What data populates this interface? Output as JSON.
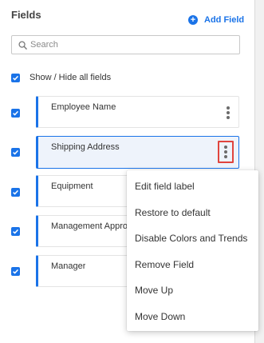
{
  "panel": {
    "title": "Fields",
    "add_field_label": "Add Field",
    "add_icon": "plus-circle-icon",
    "search": {
      "placeholder": "Search",
      "value": "",
      "icon": "search-icon"
    },
    "show_all": {
      "label": "Show / Hide all fields",
      "checked": true
    }
  },
  "fields": [
    {
      "label": "Employee Name",
      "checked": true,
      "selected": false
    },
    {
      "label": "Shipping Address",
      "checked": true,
      "selected": true
    },
    {
      "label": "Equipment",
      "checked": true,
      "selected": false
    },
    {
      "label": "Management Approval",
      "checked": true,
      "selected": false
    },
    {
      "label": "Manager",
      "checked": true,
      "selected": false
    }
  ],
  "context_menu": {
    "items": [
      "Edit field label",
      "Restore to default",
      "Disable Colors and Trends",
      "Remove Field",
      "Move Up",
      "Move Down"
    ]
  },
  "colors": {
    "accent": "#1a73e8",
    "highlight_border": "#e0443e",
    "selected_bg": "#eef3fb"
  }
}
